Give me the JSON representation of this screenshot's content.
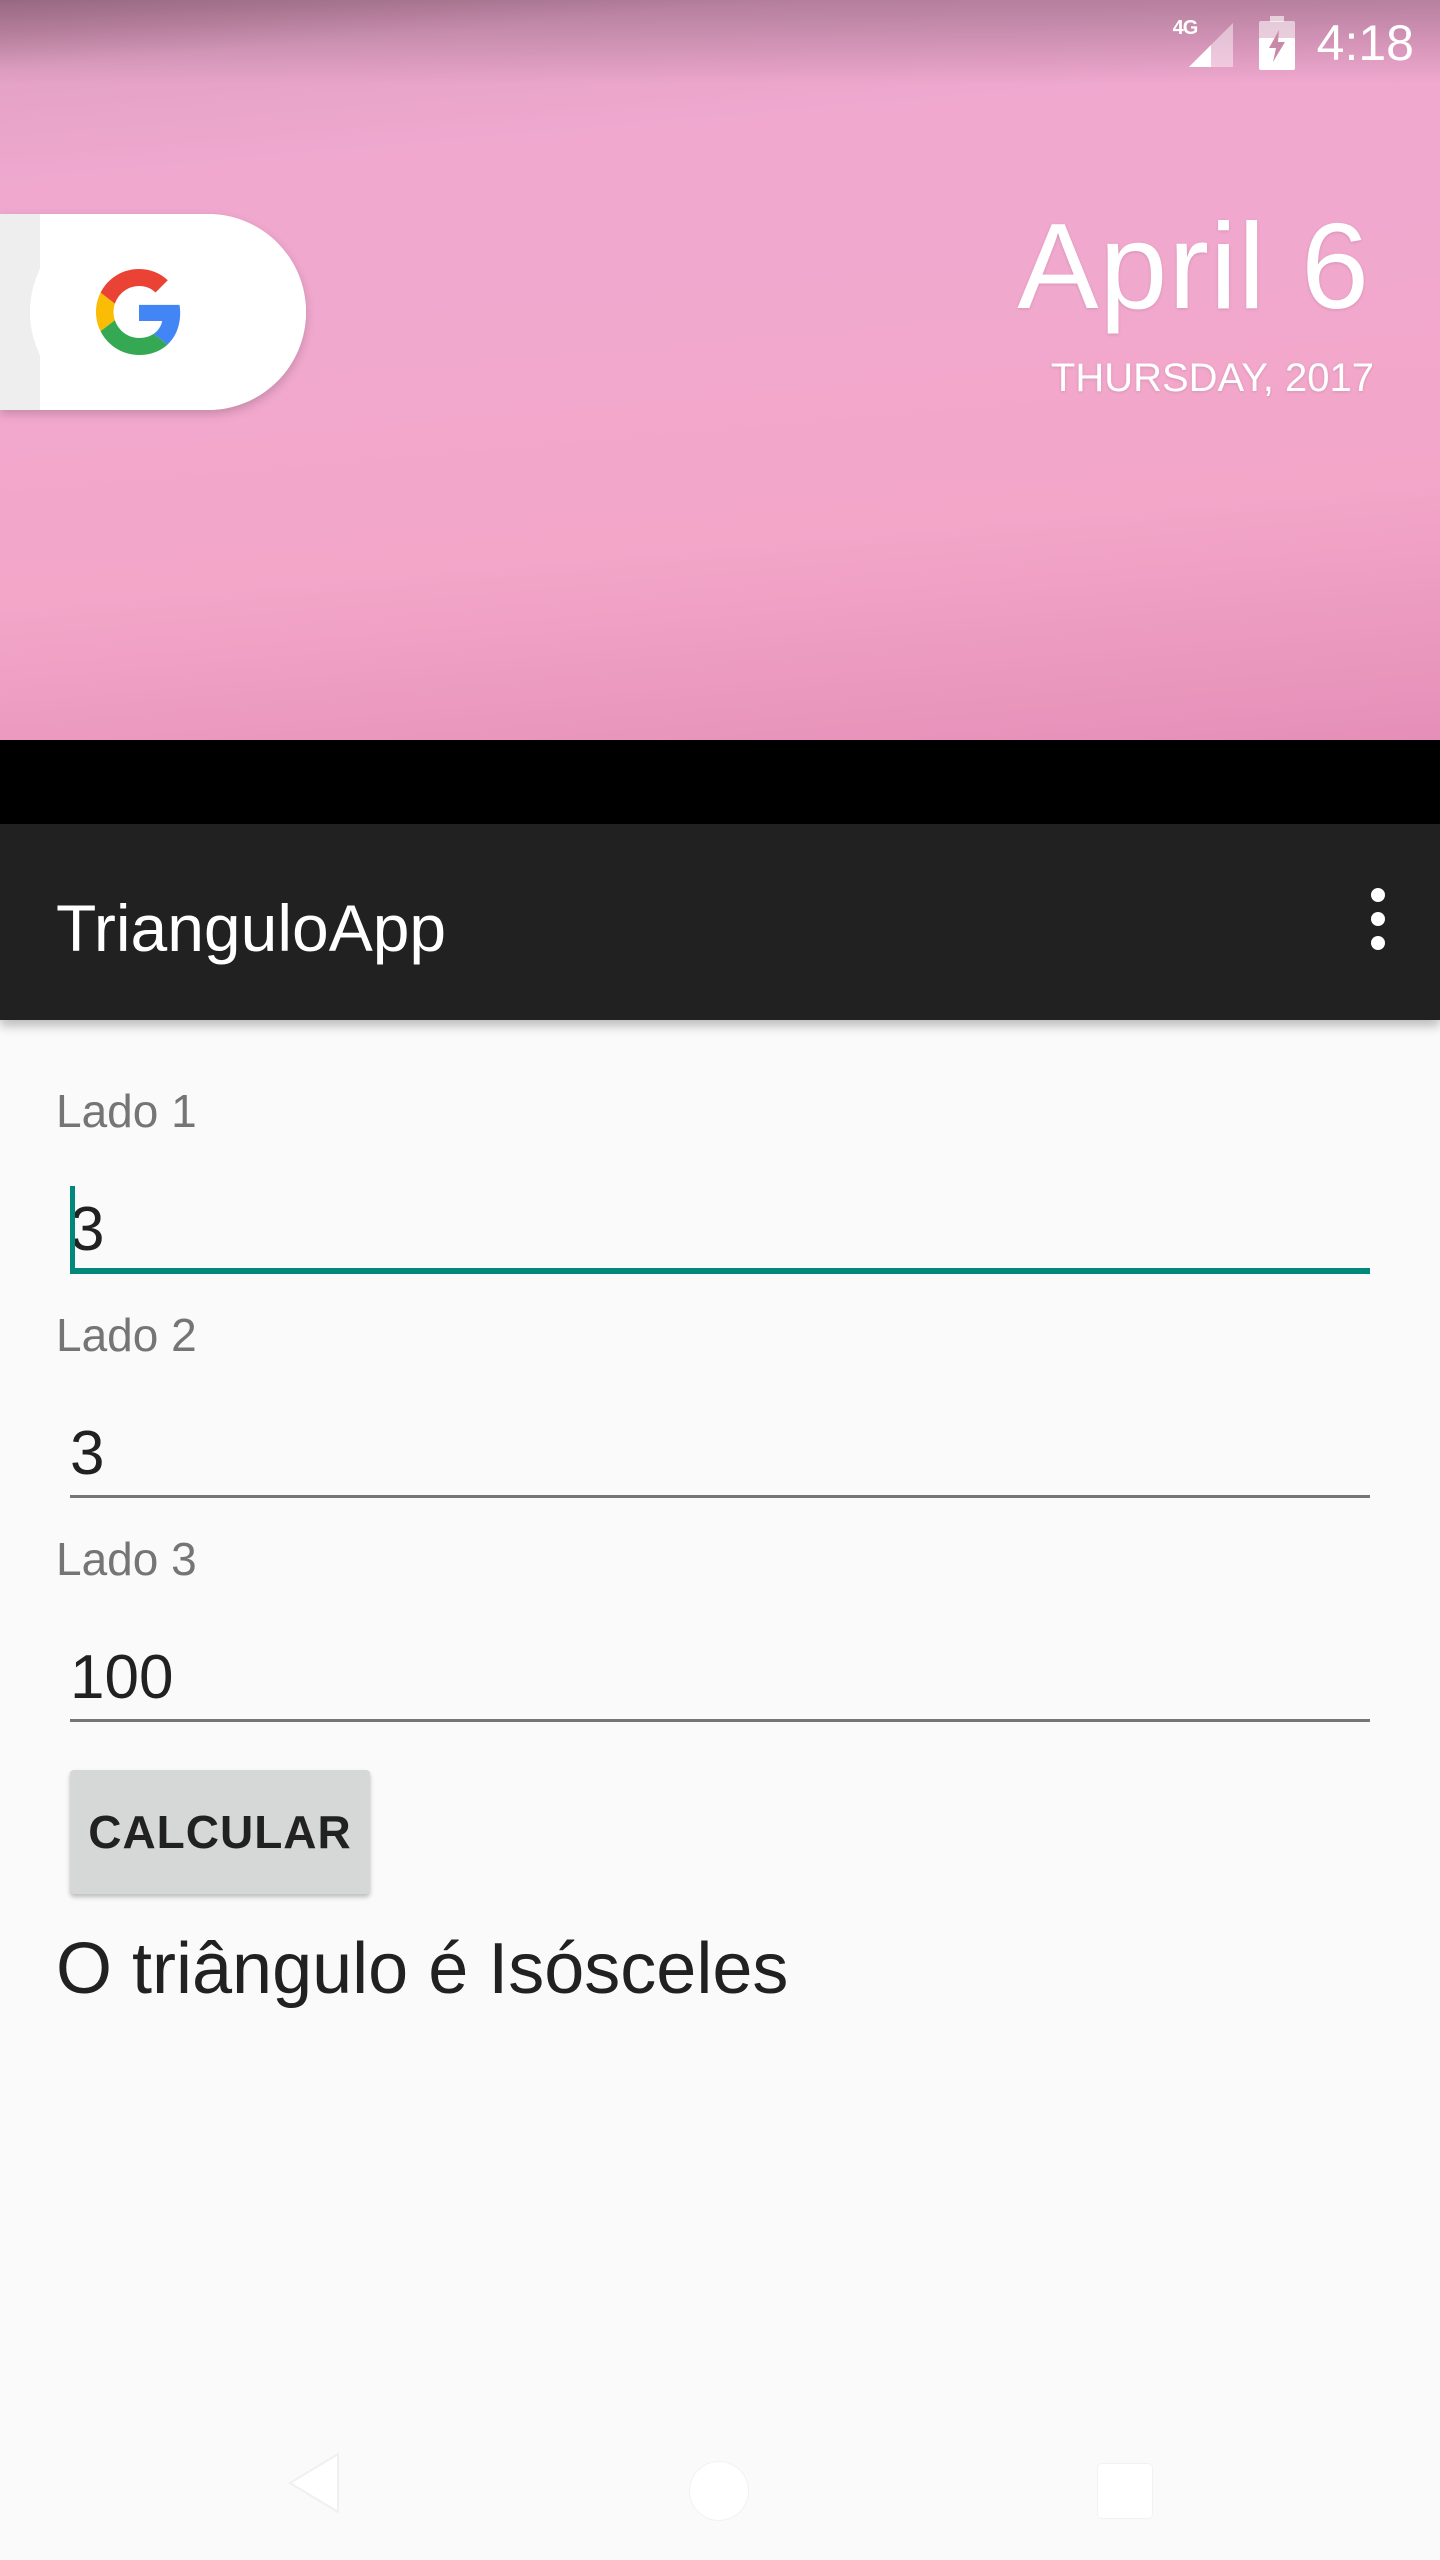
{
  "status_bar": {
    "network": "4G",
    "time": "4:18"
  },
  "home": {
    "search_widget_icon": "google-g-icon",
    "date_big": "April 6",
    "date_small": "THURSDAY, 2017"
  },
  "appbar": {
    "title": "TrianguloApp",
    "menu_icon": "overflow-menu-icon"
  },
  "form": {
    "fields": [
      {
        "label": "Lado 1",
        "value": "3"
      },
      {
        "label": "Lado 2",
        "value": "3"
      },
      {
        "label": "Lado 3",
        "value": "100"
      }
    ],
    "button_label": "CALCULAR",
    "result": "O triângulo é Isósceles"
  },
  "colors": {
    "accent": "#00897b",
    "appbar": "#212121",
    "wallpaper": "#f0a8cf"
  }
}
